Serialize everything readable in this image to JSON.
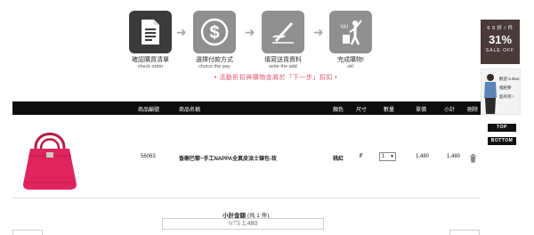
{
  "steps": [
    {
      "title": "確認購買清單",
      "subtitle": "check order",
      "icon": "document-list-icon",
      "active": true
    },
    {
      "title": "選擇付款方式",
      "subtitle": "choice the pay",
      "icon": "dollar-circle-icon",
      "active": false
    },
    {
      "title": "填寫送貨資料",
      "subtitle": "write the add",
      "icon": "hand-writing-icon",
      "active": false
    },
    {
      "title": "完成購物!",
      "subtitle": "ok!",
      "icon": "person-yay-icon",
      "icon_text": "YA!",
      "active": false
    }
  ],
  "notice": "• 活動折扣與購物金將於「下一步」扣扣 •",
  "table": {
    "headers": {
      "sku": "商品編號",
      "name": "商品名稱",
      "color": "顏色",
      "size": "尺寸",
      "qty": "數量",
      "price": "單價",
      "subtotal": "小計",
      "delete": "刪除"
    },
    "rows": [
      {
        "image_desc": "pink leather handbag",
        "sku": "56063",
        "name": "香榭巴黎~手工NAPPA全真皮派士頓包-玫",
        "color": "桃紅",
        "size": "F",
        "qty": "1",
        "price": "1,480",
        "subtotal": "1,480"
      }
    ]
  },
  "summary": {
    "label": "小計金額",
    "count": "(共 1 件)",
    "currency": "NT$",
    "amount": "1,480"
  },
  "side": {
    "sale_top": "6 9 折 / 件",
    "sale_pct": "31%",
    "sale_off": "SALE OFF",
    "model_lines": [
      "歡迎 5.6kut",
      "檔經夢",
      "超有吧 !"
    ],
    "top_label": "TOP",
    "bottom_label": "BOTTOM"
  },
  "colors": {
    "accent_pink": "#e0526a",
    "header_bg": "#0d0d0d",
    "step_active": "#3b3b3b",
    "step_inactive": "#8f8f8f",
    "bag": "#e0245e"
  }
}
